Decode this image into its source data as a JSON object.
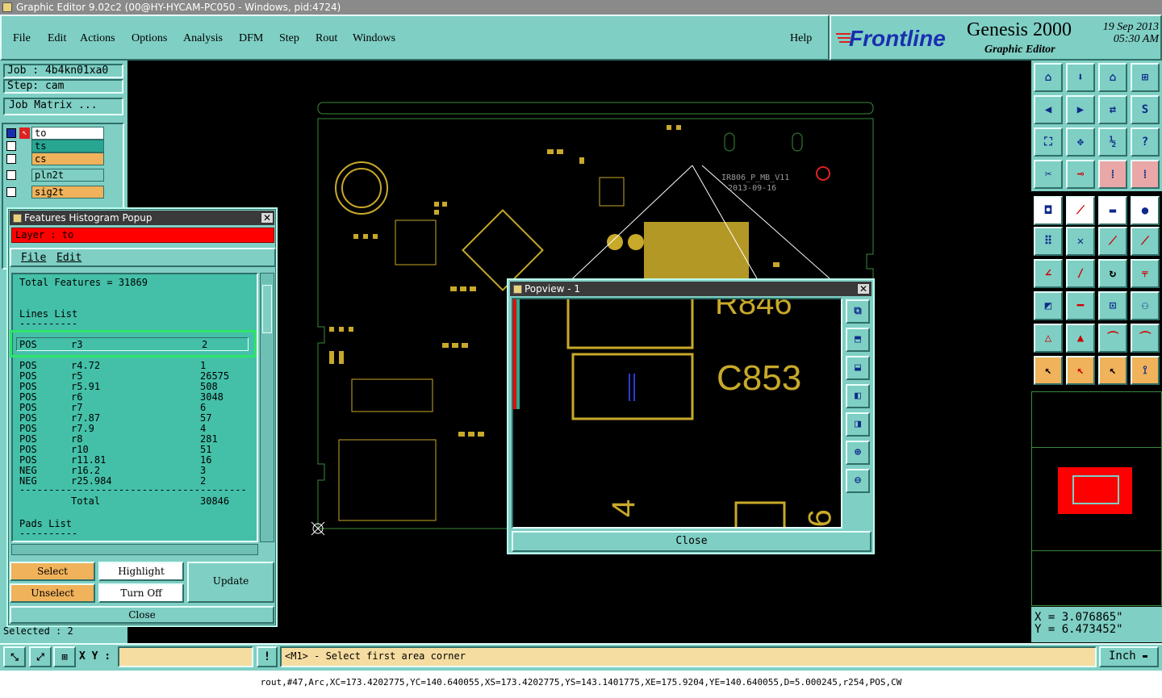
{
  "window_title": "Graphic Editor 9.02c2 (00@HY-HYCAM-PC050 - Windows, pid:4724)",
  "menu": [
    "File",
    "Edit",
    "Actions",
    "Options",
    "Analysis",
    "DFM",
    "Step",
    "Rout",
    "Windows"
  ],
  "help_label": "Help",
  "logo": {
    "brand": "Frontline",
    "product": "Genesis 2000",
    "subtitle": "Graphic Editor",
    "date": "19 Sep 2013",
    "time": "05:30 AM"
  },
  "job": "Job : 4b4kn01xa0",
  "step": "Step: cam",
  "job_matrix": "Job Matrix ...",
  "layers": [
    {
      "name": "to",
      "color": "#ffffff"
    },
    {
      "name": "ts",
      "color": "#27a793"
    },
    {
      "name": "cs",
      "color": "#f0b25a"
    },
    {
      "name": "pln2t",
      "color": "#7fcfc4"
    },
    {
      "name": "sig2t",
      "color": "#f0b25a"
    }
  ],
  "selected_text": "Selected : 2",
  "histogram": {
    "title": "Features Histogram Popup",
    "layer_label": "Layer :  to",
    "menu": [
      "File",
      "Edit"
    ],
    "total_features": "Total Features = 31869",
    "lines_list_title": "Lines List",
    "divider_short": "----------",
    "highlight_row": {
      "polarity": "POS",
      "symbol": "r3",
      "count": "2"
    },
    "rows": [
      {
        "polarity": "POS",
        "symbol": "r4.72",
        "count": "1"
      },
      {
        "polarity": "POS",
        "symbol": "r5",
        "count": "26575"
      },
      {
        "polarity": "POS",
        "symbol": "r5.91",
        "count": "508"
      },
      {
        "polarity": "POS",
        "symbol": "r6",
        "count": "3048"
      },
      {
        "polarity": "POS",
        "symbol": "r7",
        "count": "6"
      },
      {
        "polarity": "POS",
        "symbol": "r7.87",
        "count": "57"
      },
      {
        "polarity": "POS",
        "symbol": "r7.9",
        "count": "4"
      },
      {
        "polarity": "POS",
        "symbol": "r8",
        "count": "281"
      },
      {
        "polarity": "POS",
        "symbol": "r10",
        "count": "51"
      },
      {
        "polarity": "POS",
        "symbol": "r11.81",
        "count": "16"
      },
      {
        "polarity": "NEG",
        "symbol": "r16.2",
        "count": "3"
      },
      {
        "polarity": "NEG",
        "symbol": "r25.984",
        "count": "2"
      }
    ],
    "divider": "---------------------------------------",
    "total_label": "Total",
    "total_value": "30846",
    "pads_list_title": "Pads List",
    "buttons": {
      "select": "Select",
      "highlight": "Highlight",
      "update": "Update",
      "unselect": "Unselect",
      "turn_off": "Turn Off",
      "close": "Close"
    }
  },
  "popview": {
    "title": "Popview - 1",
    "close": "Close",
    "labels": [
      "R846",
      "C853",
      "4",
      "9"
    ]
  },
  "board": {
    "label": "IR806_P_MB_V11",
    "date": "2013-09-16"
  },
  "coords": {
    "x": "X = 3.076865\"",
    "y": "Y = 6.473452\""
  },
  "bottom": {
    "xy_label": "X Y :",
    "xy_value": "",
    "prompt": "<M1> - Select first area corner",
    "unit": "Inch"
  },
  "status": "rout,#47,Arc,XC=173.4202775,YC=140.640055,XS=173.4202775,YS=143.1401775,XE=175.9204,YE=140.640055,D=5.000245,r254,POS,CW"
}
